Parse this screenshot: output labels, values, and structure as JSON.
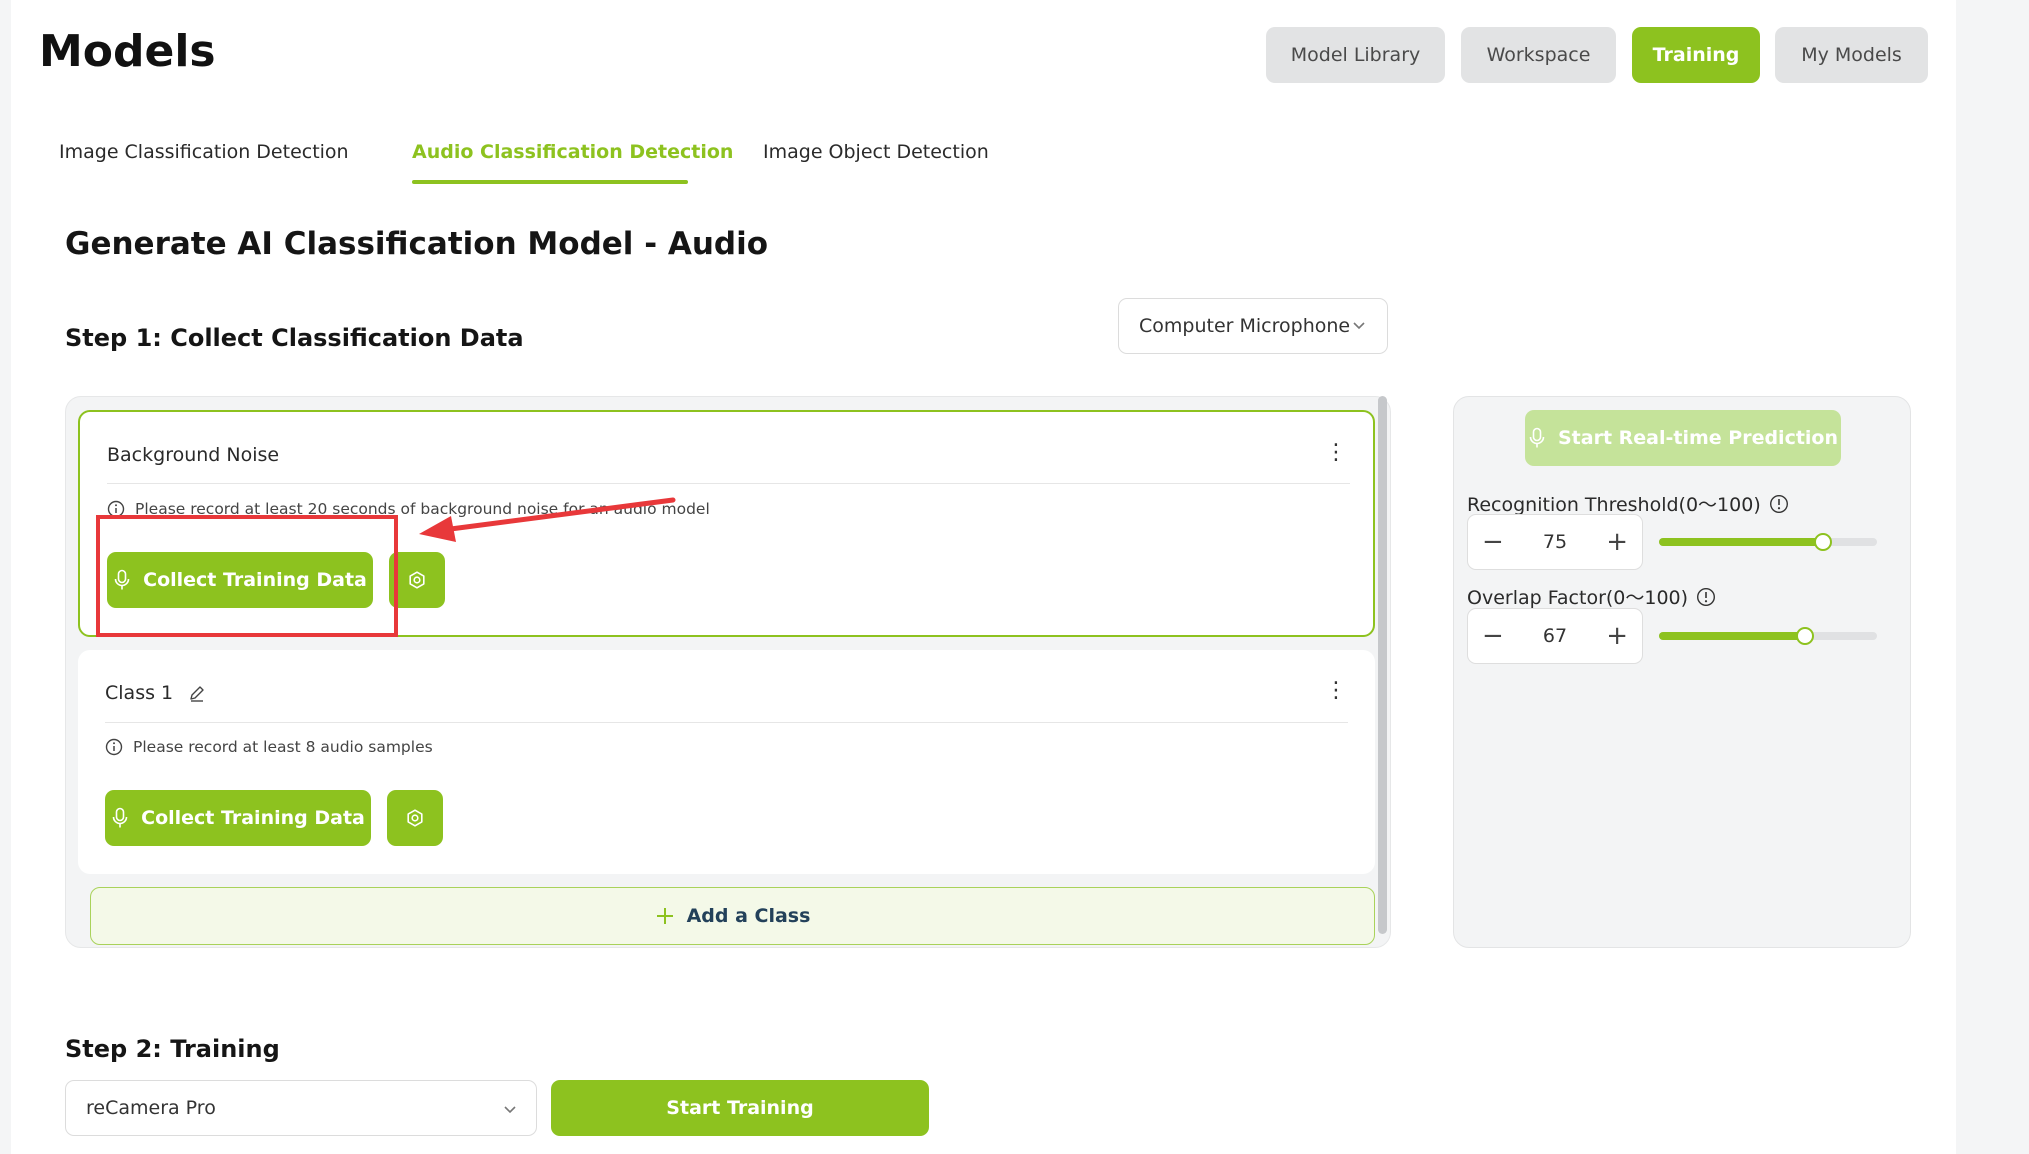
{
  "header": {
    "title": "Models",
    "nav": [
      {
        "label": "Model Library",
        "active": false
      },
      {
        "label": "Workspace",
        "active": false
      },
      {
        "label": "Training",
        "active": true
      },
      {
        "label": "My Models",
        "active": false
      }
    ]
  },
  "tabs": [
    {
      "label": "Image Classification Detection",
      "active": false
    },
    {
      "label": "Audio Classification Detection",
      "active": true
    },
    {
      "label": "Image Object Detection",
      "active": false
    }
  ],
  "page_title": "Generate AI Classification Model - Audio",
  "step1": {
    "title": "Step 1: Collect Classification Data",
    "input_source": "Computer Microphone",
    "classes": [
      {
        "name": "Background Noise",
        "info": "Please record at least 20 seconds of background noise for an audio model",
        "collect_label": "Collect Training Data",
        "selected": true
      },
      {
        "name": "Class 1",
        "info": "Please record at least 8 audio samples",
        "collect_label": "Collect Training Data",
        "selected": false
      }
    ],
    "add_class_label": "Add a Class"
  },
  "prediction": {
    "button_label": "Start Real-time Prediction",
    "threshold": {
      "label": "Recognition Threshold(0～100)",
      "value": "75",
      "percent": 75
    },
    "overlap": {
      "label": "Overlap Factor(0～100)",
      "value": "67",
      "percent": 67
    }
  },
  "step2": {
    "title": "Step 2: Training",
    "device": "reCamera Pro",
    "start_label": "Start Training"
  },
  "colors": {
    "accent": "#8dc21f",
    "accent_light": "#c5e39a",
    "annotation": "#e8383a"
  }
}
